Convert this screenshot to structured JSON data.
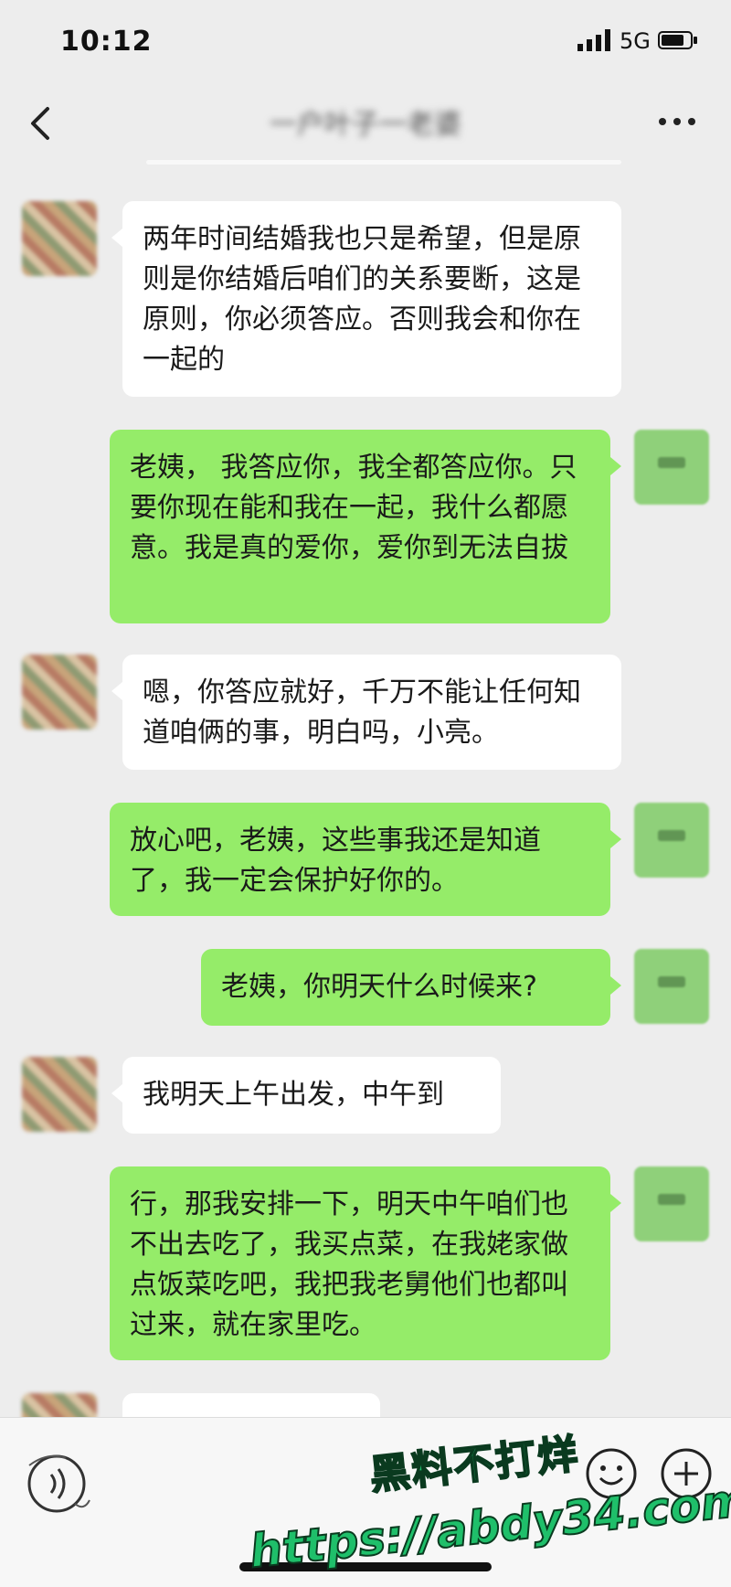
{
  "status_bar": {
    "time": "10:12",
    "network": "5G"
  },
  "nav": {
    "title": "一户叶子一老婆"
  },
  "messages": [
    {
      "side": "left",
      "text": "两年时间结婚我也只是希望，但是原则是你结婚后咱们的关系要断，这是原则，你必须答应。否则我会和你在一起的"
    },
    {
      "side": "right",
      "text": "老姨， 我答应你，我全都答应你。只要你现在能和我在一起，我什么都愿意。我是真的爱你，爱你到无法自拔"
    },
    {
      "side": "left",
      "text": "嗯，你答应就好，千万不能让任何知道咱俩的事，明白吗，小亮。"
    },
    {
      "side": "right",
      "text": "放心吧，老姨，这些事我还是知道了，我一定会保护好你的。"
    },
    {
      "side": "right",
      "text": "老姨，你明天什么时候来?"
    },
    {
      "side": "left",
      "text": "我明天上午出发，中午到"
    },
    {
      "side": "right",
      "text": "行，那我安排一下，明天中午咱们也不出去吃了，我买点菜，在我姥家做点饭菜吃吧，我把我老舅他们也都叫过来，就在家里吃。"
    },
    {
      "side": "left",
      "text": ""
    }
  ],
  "watermark": {
    "line1": "黑料不打烊",
    "line2": "https://abdy34.com"
  },
  "colors": {
    "sent_bubble": "#95ec69",
    "received_bubble": "#ffffff",
    "background": "#ededed"
  }
}
